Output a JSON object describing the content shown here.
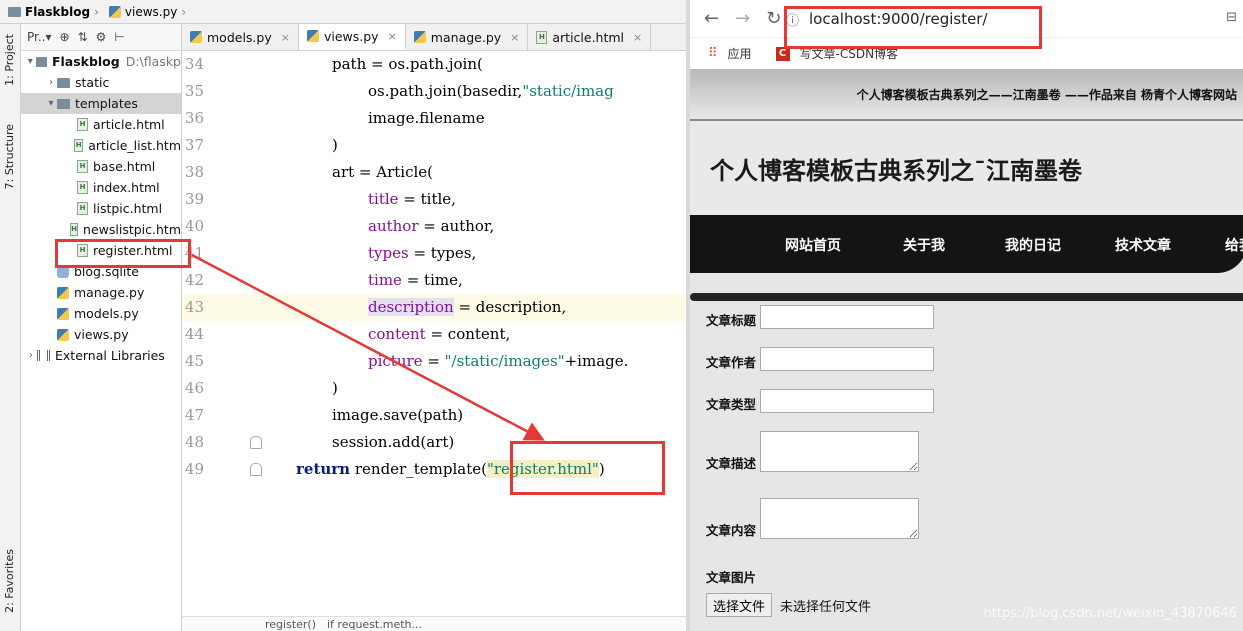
{
  "ide": {
    "breadcrumb": {
      "project": "Flaskblog",
      "file": "views.py"
    },
    "sidebar_tabs": {
      "project": "1: Project",
      "structure": "7: Structure",
      "favorites": "2: Favorites"
    },
    "project_toolbar": {
      "label": "Pr..▾"
    },
    "tree": [
      {
        "label": "Flaskblog",
        "extra": "D:\\flaskp",
        "type": "folder",
        "level": 0,
        "expanded": true
      },
      {
        "label": "static",
        "type": "folder",
        "level": 1,
        "expanded": false
      },
      {
        "label": "templates",
        "type": "folder",
        "level": 1,
        "expanded": true,
        "selected": true
      },
      {
        "label": "article.html",
        "type": "html",
        "level": 2
      },
      {
        "label": "article_list.htm",
        "type": "html",
        "level": 2
      },
      {
        "label": "base.html",
        "type": "html",
        "level": 2
      },
      {
        "label": "index.html",
        "type": "html",
        "level": 2
      },
      {
        "label": "listpic.html",
        "type": "html",
        "level": 2
      },
      {
        "label": "newslistpic.htm",
        "type": "html",
        "level": 2
      },
      {
        "label": "register.html",
        "type": "html",
        "level": 2
      },
      {
        "label": "blog.sqlite",
        "type": "db",
        "level": 1
      },
      {
        "label": "manage.py",
        "type": "py",
        "level": 1
      },
      {
        "label": "models.py",
        "type": "py",
        "level": 1
      },
      {
        "label": "views.py",
        "type": "py",
        "level": 1
      },
      {
        "label": "External Libraries",
        "type": "lib",
        "level": 0,
        "expanded": false
      }
    ],
    "tabs": [
      {
        "label": "models.py",
        "type": "py"
      },
      {
        "label": "views.py",
        "type": "py",
        "active": true
      },
      {
        "label": "manage.py",
        "type": "py"
      },
      {
        "label": "article.html",
        "type": "html"
      }
    ],
    "code_lines": [
      {
        "n": "34",
        "text": "path = os.path.join("
      },
      {
        "n": "35",
        "text": "os.path.join(basedir,\"static/imag"
      },
      {
        "n": "36",
        "text": "image.filename"
      },
      {
        "n": "37",
        "text": ")"
      },
      {
        "n": "38",
        "text": "art = Article("
      },
      {
        "n": "39",
        "text": "title = title,"
      },
      {
        "n": "40",
        "text": "author = author,"
      },
      {
        "n": "41",
        "text": "types = types,"
      },
      {
        "n": "42",
        "text": "time = time,"
      },
      {
        "n": "43",
        "text": "description = description,"
      },
      {
        "n": "44",
        "text": "content = content,"
      },
      {
        "n": "45",
        "text": "picture = \"/static/images\"+image."
      },
      {
        "n": "46",
        "text": ")"
      },
      {
        "n": "47",
        "text": "image.save(path)"
      },
      {
        "n": "48",
        "text": "session.add(art)"
      },
      {
        "n": "49",
        "text": "return render_template(\"register.html\")"
      }
    ],
    "status": {
      "function": "register()",
      "branch": "if request.meth..."
    }
  },
  "browser": {
    "url": "localhost:9000/register/",
    "bookmarks": {
      "apps": "应用",
      "csdn": "写文章-CSDN博客"
    },
    "site": {
      "top_line": "个人博客模板古典系列之——江南墨卷 ——作品来自 杨青个人博客网站",
      "title": "个人博客模板古典系列之¯江南墨卷",
      "nav": [
        "网站首页",
        "关于我",
        "我的日记",
        "技术文章",
        "给我"
      ],
      "form": {
        "title_label": "文章标题",
        "author_label": "文章作者",
        "type_label": "文章类型",
        "desc_label": "文章描述",
        "content_label": "文章内容",
        "pic_label": "文章图片",
        "file_button": "选择文件",
        "file_none": "未选择任何文件"
      }
    },
    "watermark": "https://blog.csdn.net/weixin_43870646"
  },
  "colors": {
    "annotation_red": "#e53935",
    "string_green": "#0a7f6c",
    "keyword_navy": "#0a1a7f",
    "param_purple": "#871094"
  }
}
